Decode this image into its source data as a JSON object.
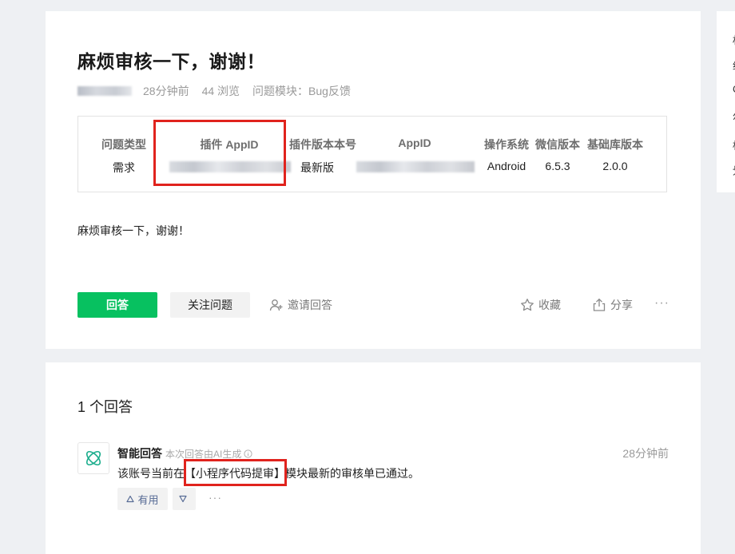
{
  "question": {
    "title": "麻烦审核一下，谢谢！",
    "meta": {
      "time": "28分钟前",
      "views": "44 浏览",
      "module_label": "问题模块：",
      "module_value": "Bug反馈"
    },
    "info": {
      "columns": [
        {
          "header": "问题类型",
          "value": "需求"
        },
        {
          "header": "插件 AppID",
          "value": ""
        },
        {
          "header": "插件版本本号",
          "value": "最新版"
        },
        {
          "header": "AppID",
          "value": ""
        },
        {
          "header": "操作系统",
          "value": "Android"
        },
        {
          "header": "微信版本",
          "value": "6.5.3"
        },
        {
          "header": "基础库版本",
          "value": "2.0.0"
        }
      ]
    },
    "body": "麻烦审核一下，谢谢！",
    "actions": {
      "answer": "回答",
      "follow": "关注问题",
      "invite": "邀请回答",
      "favorite": "收藏",
      "share": "分享",
      "more": "···"
    }
  },
  "answers": {
    "count_label": "1 个回答",
    "items": [
      {
        "author": "智能回答",
        "note": "本次回答由AI生成",
        "time": "28分钟前",
        "text_before": "该账号当前在",
        "text_highlight": "【小程序代码提审】",
        "text_after": "模块最新的审核单已通过。",
        "useful_label": "有用",
        "more": "···"
      }
    ]
  },
  "side_panel": {
    "glyphs": [
      "权",
      "约",
      "C",
      "尔",
      "标",
      "划"
    ]
  },
  "colors": {
    "primary": "#07c160",
    "highlight": "#e0231d",
    "link": "#576b95"
  }
}
